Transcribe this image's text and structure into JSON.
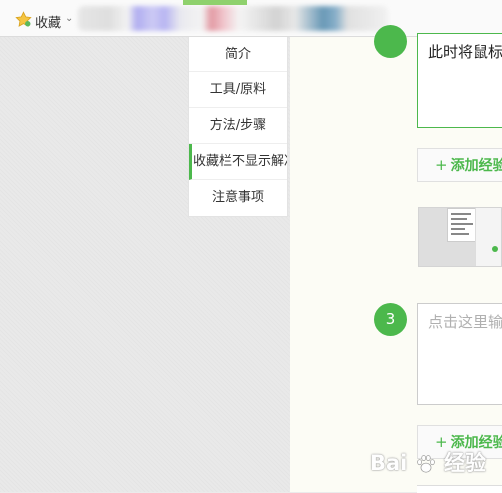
{
  "favorites_bar": {
    "label": "收藏",
    "star_icon": "star-icon",
    "chevron_icon": "chevron-down-icon"
  },
  "toc": {
    "items": [
      {
        "label": "简介"
      },
      {
        "label": "工具/原料"
      },
      {
        "label": "方法/步骤"
      },
      {
        "label": "收藏栏不显示解决"
      },
      {
        "label": "注意事项"
      }
    ],
    "active_index": 3,
    "accent_color": "#4cb84c"
  },
  "editor": {
    "step2": {
      "text": "此时将鼠标"
    },
    "add_experience_label": "添加经验",
    "add_experience_label_2": "添加经验",
    "step3": {
      "number": "3",
      "placeholder": "点击这里输"
    }
  },
  "watermark": {
    "text": "Bai",
    "text2": "经验"
  },
  "colors": {
    "accent": "#4cb84c",
    "page_bg": "#e9e9e9",
    "content_bg": "#fcfcf5"
  }
}
